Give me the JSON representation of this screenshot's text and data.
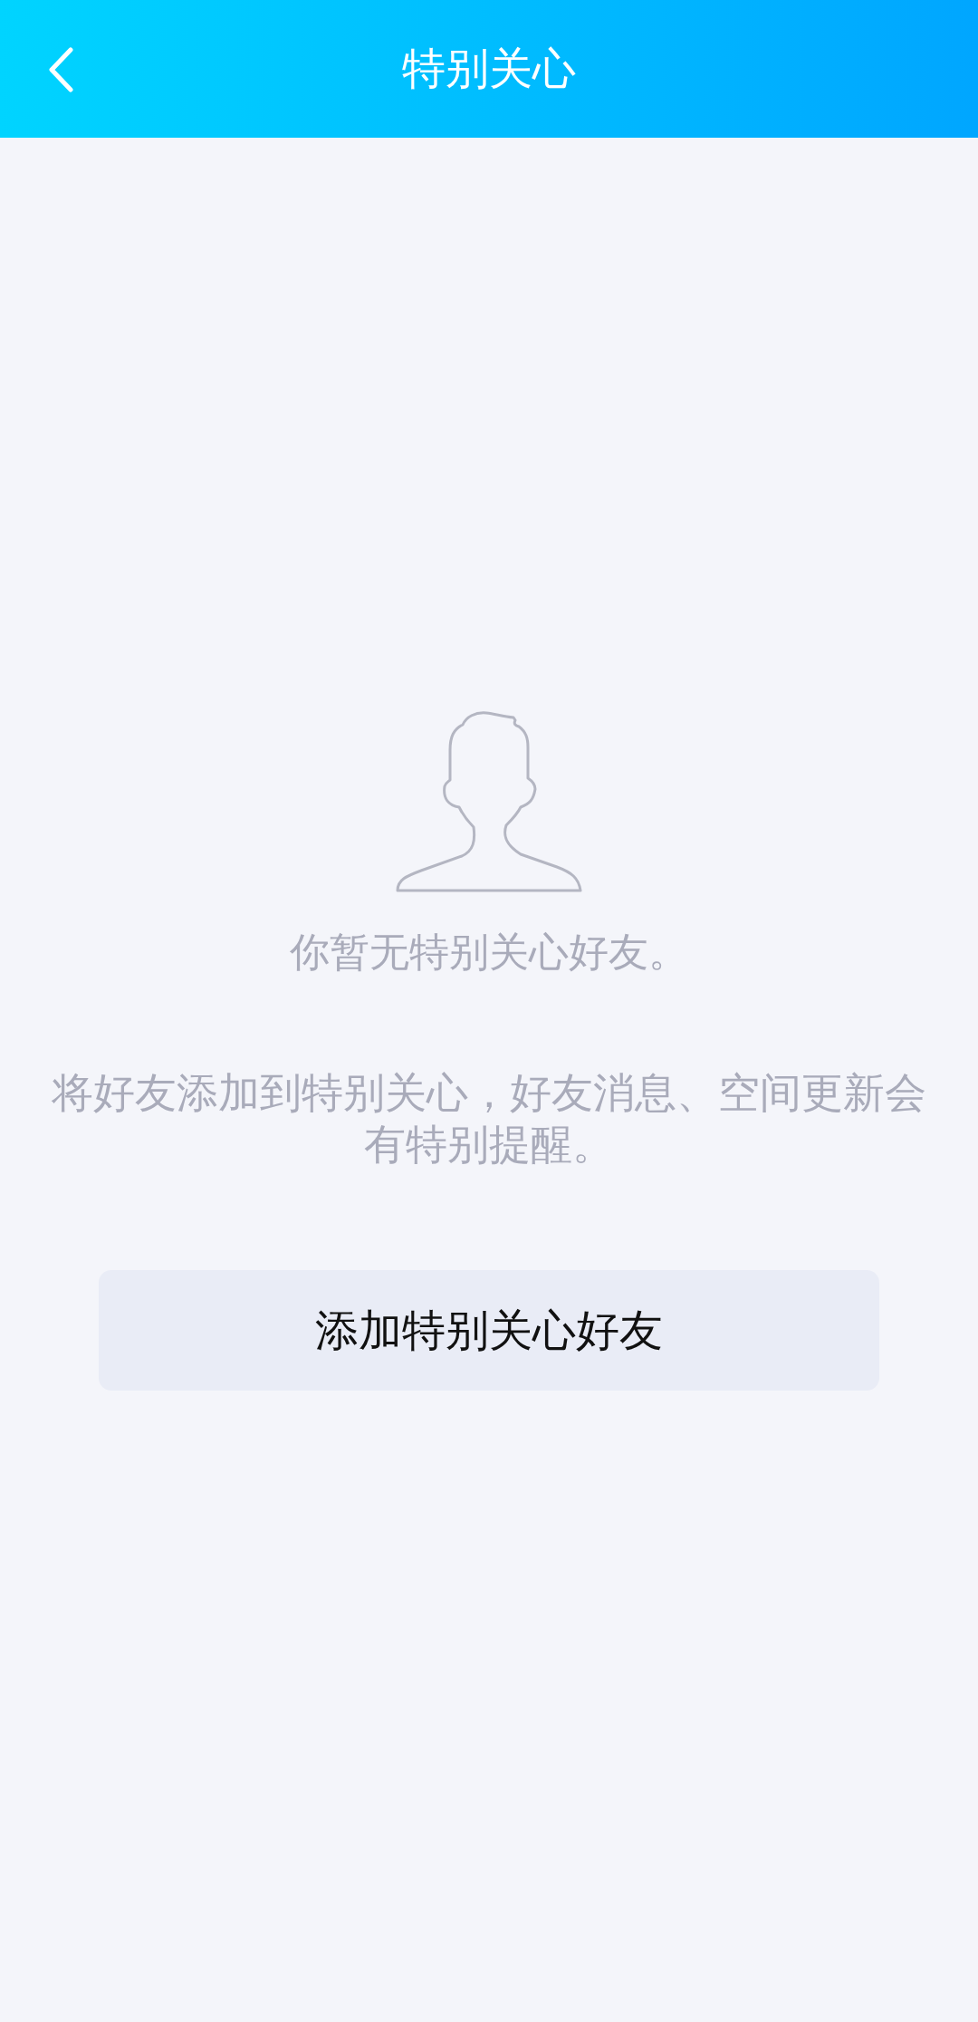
{
  "header": {
    "title": "特别关心"
  },
  "empty_state": {
    "message": "你暂无特别关心好友。",
    "description": "将好友添加到特别关心，好友消息、空间更新会有特别提醒。"
  },
  "button": {
    "label": "添加特别关心好友"
  }
}
